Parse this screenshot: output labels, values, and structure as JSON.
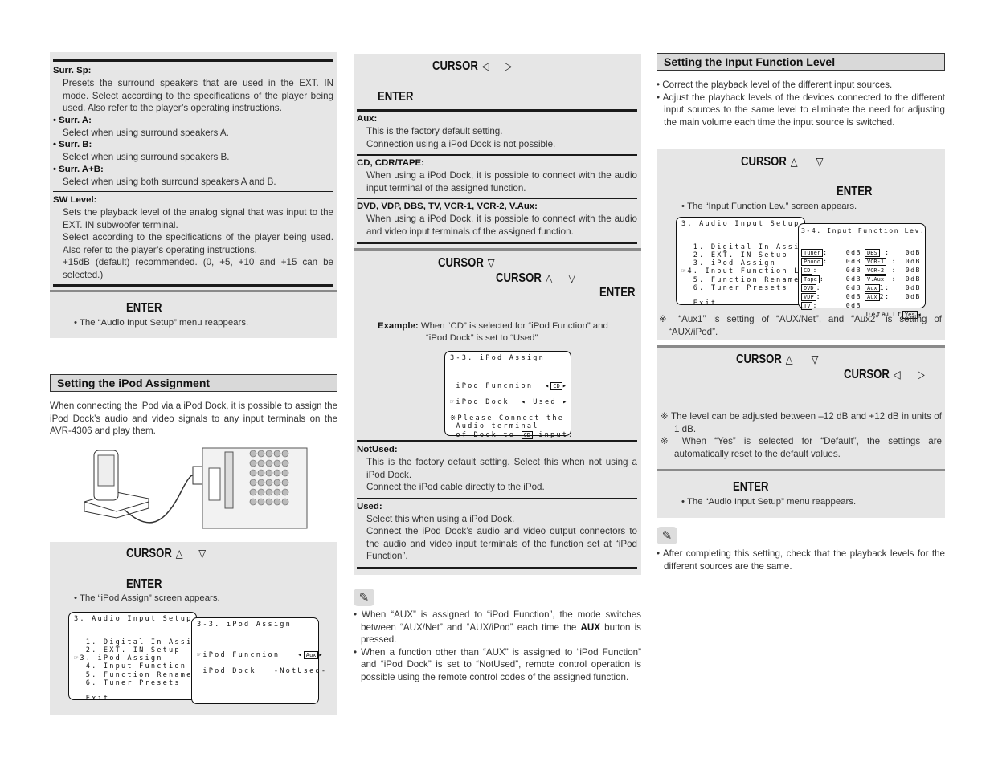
{
  "left": {
    "settings": [
      {
        "term": "Surr. Sp:",
        "desc": "Presets the surround speakers that are used in the EXT. IN mode. Select according to the specifications of the player being used. Also refer to the player’s operating instructions.",
        "subs": [
          {
            "term": "Surr. A:",
            "desc": "Select when using surround speakers A."
          },
          {
            "term": "Surr. B:",
            "desc": "Select when using surround speakers B."
          },
          {
            "term": "Surr. A+B:",
            "desc": "Select when using both surround speakers A and B."
          }
        ]
      },
      {
        "term": "SW Level:",
        "desc": "Sets the playback level of the analog signal that was input to the EXT. IN subwoofer terminal.",
        "desc2": "Select according to the specifications of the player being used. Also refer to the player’s operating instructions.",
        "desc3": "+15dB (default) recommended. (0, +5, +10 and +15 can be selected.)"
      }
    ],
    "step_enter": {
      "key": "ENTER",
      "note": "The “Audio Input Setup” menu reappears."
    },
    "section_title": "Setting the iPod Assignment",
    "intro": "When connecting the iPod via a iPod Dock, it is possible to assign the iPod Dock’s audio and video signals to any input terminals on the AVR-4306 and play them.",
    "step_cursor": {
      "key": "CURSOR",
      "up": "△",
      "down": "▽"
    },
    "step_enter2": {
      "key": "ENTER",
      "note": "The “iPod Assign” screen appears."
    },
    "menu_screen": {
      "title": "3. Audio Input Setup",
      "items": [
        "  1. Digital In Assign",
        "  2. EXT. IN Setup",
        "☞3. iPod Assign",
        "  4. Input Function Lev.",
        "  5. Function Rename",
        "  6. Tuner Presets"
      ],
      "exit": "  Exit"
    },
    "ipod_screen": {
      "title": "3-3. iPod Assign",
      "func_label": "☞iPod Funcnion",
      "func_value": "Aux",
      "dock_label": " iPod Dock",
      "dock_value": "-NotUsed-"
    }
  },
  "middle": {
    "step_cursor": {
      "key": "CURSOR",
      "left": "◁",
      "right": "▷"
    },
    "step_enter": {
      "key": "ENTER"
    },
    "options": [
      {
        "term": "Aux:",
        "lines": [
          "This is the factory default setting.",
          "Connection using a iPod Dock is not possible."
        ]
      },
      {
        "term": "CD, CDR/TAPE:",
        "lines": [
          "When using a iPod Dock, it is possible to connect with the audio input terminal of the assigned function."
        ]
      },
      {
        "term": "DVD, VDP, DBS, TV, VCR-1, VCR-2, V.Aux:",
        "lines": [
          "When using a iPod Dock, it is possible to connect with the audio and video input terminals of the assigned function."
        ]
      }
    ],
    "step_cursor_down": {
      "key": "CURSOR",
      "down": "▽"
    },
    "step_cursor_updown": {
      "key": "CURSOR",
      "up": "△",
      "down": "▽"
    },
    "step_enter2": {
      "key": "ENTER"
    },
    "example_label": "Example:",
    "example_text": "When “CD” is selected for “iPod Function” and",
    "example_text2": "“iPod Dock” is set to “Used”",
    "example_screen": {
      "title": "3-3. iPod Assign",
      "func_label": " iPod Funcnion",
      "func_value": "CD",
      "dock_label": "☞iPod Dock",
      "dock_value": "Used",
      "msg1": "※Please Connect the",
      "msg2": " Audio terminal",
      "msg3a": " of Dock to ",
      "msg3b": "CD",
      "msg3c": " input."
    },
    "dock_options": [
      {
        "term": "NotUsed:",
        "lines": [
          "This is the factory default setting. Select this when not using a iPod Dock.",
          "Connect the iPod cable directly to the iPod."
        ]
      },
      {
        "term": "Used:",
        "lines": [
          "Select this when using a iPod Dock.",
          "Connect the iPod Dock’s audio and video output connectors to the audio and video input terminals of the function set at “iPod Function”."
        ]
      }
    ],
    "notes": [
      {
        "pre": "When “AUX” is assigned to “iPod Function”, the mode switches between “AUX/Net” and “AUX/iPod” each time the ",
        "bold": "AUX",
        "post": " button is pressed."
      },
      {
        "pre": "When a function other than “AUX” is assigned to “iPod Function” and “iPod Dock” is set to “NotUsed”, remote control operation is possible using the remote control codes of the assigned function.",
        "bold": "",
        "post": ""
      }
    ]
  },
  "right": {
    "section_title": "Setting the Input Function Level",
    "bullets": [
      "Correct the playback level of the different input sources.",
      "Adjust the playback levels of the devices connected to the different input sources to the same level to eliminate the need for adjusting the main volume each time the input source is switched."
    ],
    "step_cursor": {
      "key": "CURSOR",
      "up": "△",
      "down": "▽"
    },
    "step_enter": {
      "key": "ENTER",
      "note": "The “Input Function Lev.” screen appears."
    },
    "menu_screen": {
      "title": "3. Audio Input Setup",
      "items": [
        "  1. Digital In Assign",
        "  2. EXT. IN Setup",
        "  3. iPod Assign",
        "☞4. Input Function Lev.",
        "  5. Function Rename",
        "  6. Tuner Presets"
      ],
      "exit": "  Exit"
    },
    "level_screen": {
      "title": "3-4. Input Function Lev.",
      "left_col": [
        {
          "name": "Tuner",
          "value": "0dB"
        },
        {
          "name": "Phono",
          "value": "0dB"
        },
        {
          "name": "CD",
          "value": "0dB"
        },
        {
          "name": "Tape",
          "value": "0dB"
        },
        {
          "name": "DVD",
          "value": "0dB"
        },
        {
          "name": "VDP",
          "value": "0dB"
        },
        {
          "name": "TV",
          "value": "0dB"
        }
      ],
      "right_col": [
        {
          "name": "DBS",
          "suffix": " ",
          "value": "0dB"
        },
        {
          "name": "VCR-1",
          "suffix": " ",
          "value": "0dB"
        },
        {
          "name": "VCR-2",
          "suffix": " ",
          "value": "0dB"
        },
        {
          "name": "V.Aux",
          "suffix": " ",
          "value": "0dB"
        },
        {
          "name": "Aux",
          "suffix": "1",
          "value": "0dB"
        },
        {
          "name": "Aux",
          "suffix": "2",
          "value": "0dB"
        }
      ],
      "default_label": "Default",
      "default_value": "Yes"
    },
    "ref_note": "“Aux1” is setting of “AUX/Net”, and “Aux2” is setting of “AUX/iPod”.",
    "step_cursor_updown": {
      "key": "CURSOR",
      "up": "△",
      "down": "▽"
    },
    "step_cursor_lr": {
      "key": "CURSOR",
      "left": "◁",
      "right": "▷"
    },
    "refs": [
      "The level can be adjusted between –12 dB and +12 dB in units of 1 dB.",
      "When “Yes” is selected for “Default”, the settings are automatically reset to the default values."
    ],
    "step_enter2": {
      "key": "ENTER",
      "note": "The “Audio Input Setup” menu reappears."
    },
    "final_note": "After completing this setting, check that the playback levels for the different sources are the same."
  },
  "colors": {
    "panel": "#e6e6e6",
    "heading_bg": "#d9d9d9",
    "rule": "#1a1a1a"
  }
}
